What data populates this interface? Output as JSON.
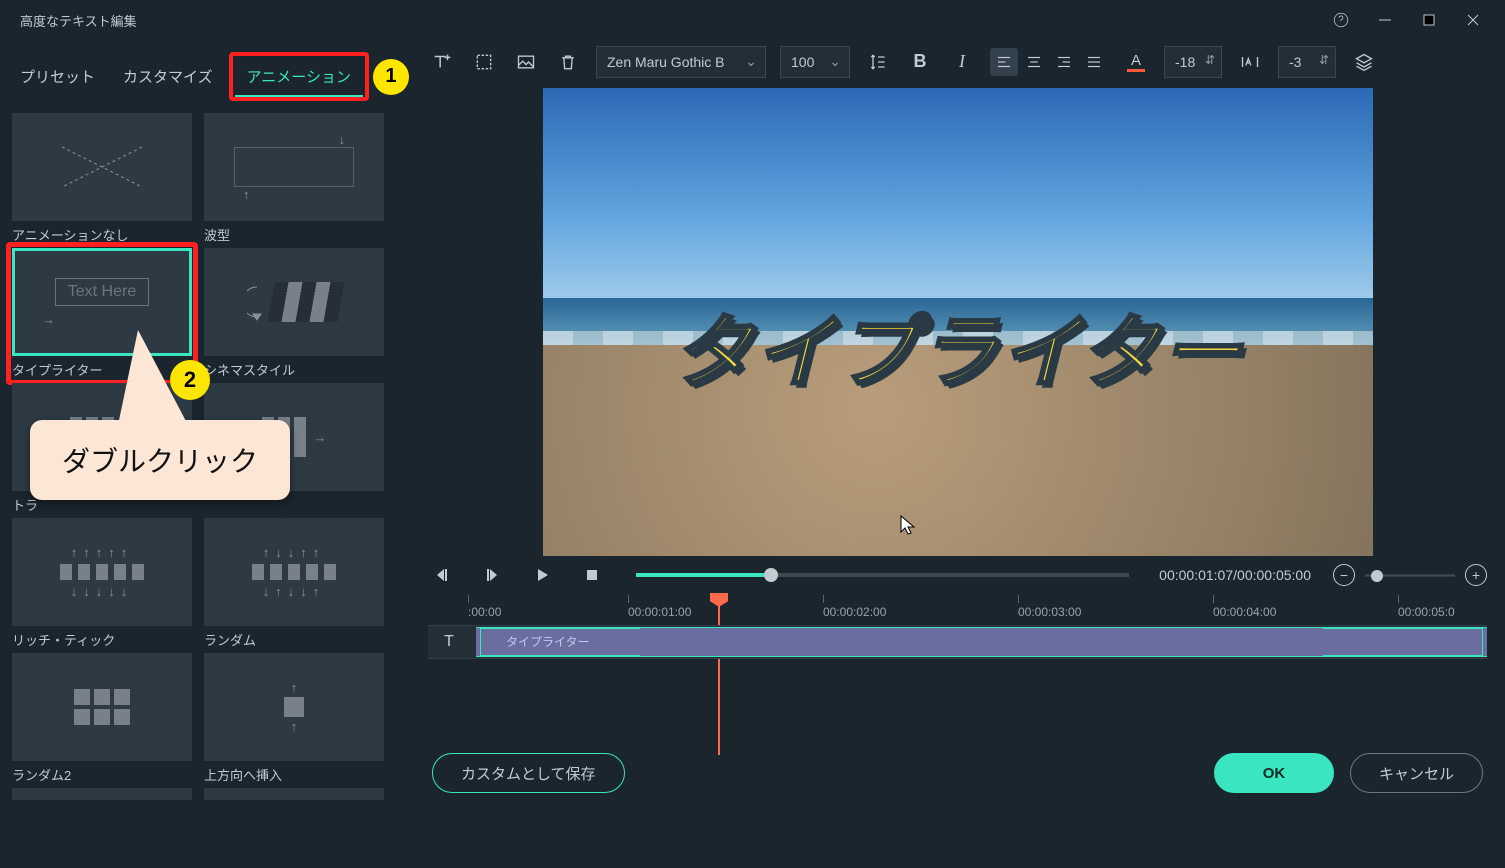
{
  "window": {
    "title": "高度なテキスト編集"
  },
  "tabs": {
    "preset": "プリセット",
    "customize": "カスタマイズ",
    "animation": "アニメーション"
  },
  "annotations": {
    "badge1": "1",
    "badge2": "2",
    "callout": "ダブルクリック"
  },
  "presets": {
    "noAnimation": "アニメーションなし",
    "wave": "波型",
    "typewriter": "タイプライター",
    "cinema": "シネマスタイル",
    "tr": "トラ",
    "empty": "",
    "richTick": "リッチ・ティック",
    "random": "ランダム",
    "random2": "ランダム2",
    "insertUp": "上方向へ挿入",
    "textHere": "Text Here"
  },
  "toolbar": {
    "font": "Zen Maru Gothic B",
    "fontSize": "100",
    "letterSpacing": "-18",
    "lineSpacing": "-3",
    "bold": "B",
    "italic": "I",
    "underlineA": "A"
  },
  "preview": {
    "text": "タイプライター"
  },
  "playback": {
    "current": "00:00:01:07",
    "total": "00:00:05:00"
  },
  "ruler": {
    "t0": ":00:00",
    "t1": "00:00:01:00",
    "t2": "00:00:02:00",
    "t3": "00:00:03:00",
    "t4": "00:00:04:00",
    "t5": "00:00:05:0"
  },
  "clip": {
    "label": "タイプライター",
    "trackIcon": "T"
  },
  "footer": {
    "saveCustom": "カスタムとして保存",
    "ok": "OK",
    "cancel": "キャンセル"
  }
}
